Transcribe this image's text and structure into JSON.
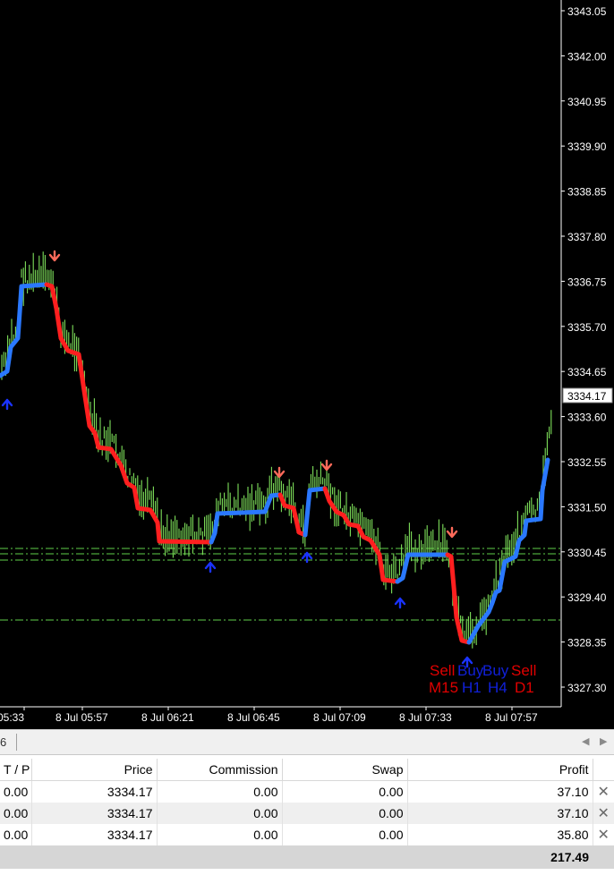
{
  "chart": {
    "price_axis_labels": [
      "3343.05",
      "3342.00",
      "3340.95",
      "3339.90",
      "3338.85",
      "3337.80",
      "3336.75",
      "3335.70",
      "3334.65",
      "3333.60",
      "3332.55",
      "3331.50",
      "3330.45",
      "3329.40",
      "3328.35",
      "3327.30"
    ],
    "current_price": "3334.17",
    "time_axis_labels": [
      "05:33",
      "8 Jul 05:57",
      "8 Jul 06:21",
      "8 Jul 06:45",
      "8 Jul 07:09",
      "8 Jul 07:33",
      "8 Jul 07:57"
    ],
    "signal_panel": {
      "signals": [
        {
          "text": "Sell",
          "color": "#e00000"
        },
        {
          "text": "Buy",
          "color": "#1020d8"
        },
        {
          "text": "Buy",
          "color": "#1020d8"
        },
        {
          "text": "Sell",
          "color": "#e00000"
        }
      ],
      "timeframes": [
        {
          "text": "M15",
          "color": "#e00000"
        },
        {
          "text": "H1",
          "color": "#1020d8"
        },
        {
          "text": "H4",
          "color": "#1020d8"
        },
        {
          "text": "D1",
          "color": "#e00000"
        }
      ]
    },
    "colors": {
      "background": "#000000",
      "candles": "#7ee05a",
      "trend_up": "#2a78ff",
      "trend_down": "#ff1f1f",
      "buy_arrow": "#1a33ff",
      "sell_arrow": "#ff6a5a",
      "level_lines": "#5fcf4a"
    }
  },
  "tab_bar": {
    "fragment": "6",
    "left_arrow": "◀",
    "right_arrow": "▶"
  },
  "trade_table": {
    "headers": {
      "tp": "T / P",
      "price": "Price",
      "commission": "Commission",
      "swap": "Swap",
      "profit": "Profit"
    },
    "rows": [
      {
        "tp": "0.00",
        "price": "3334.17",
        "commission": "0.00",
        "swap": "0.00",
        "profit": "37.10"
      },
      {
        "tp": "0.00",
        "price": "3334.17",
        "commission": "0.00",
        "swap": "0.00",
        "profit": "37.10"
      },
      {
        "tp": "0.00",
        "price": "3334.17",
        "commission": "0.00",
        "swap": "0.00",
        "profit": "35.80"
      }
    ],
    "total_profit": "217.49",
    "close_icon": "✕"
  }
}
